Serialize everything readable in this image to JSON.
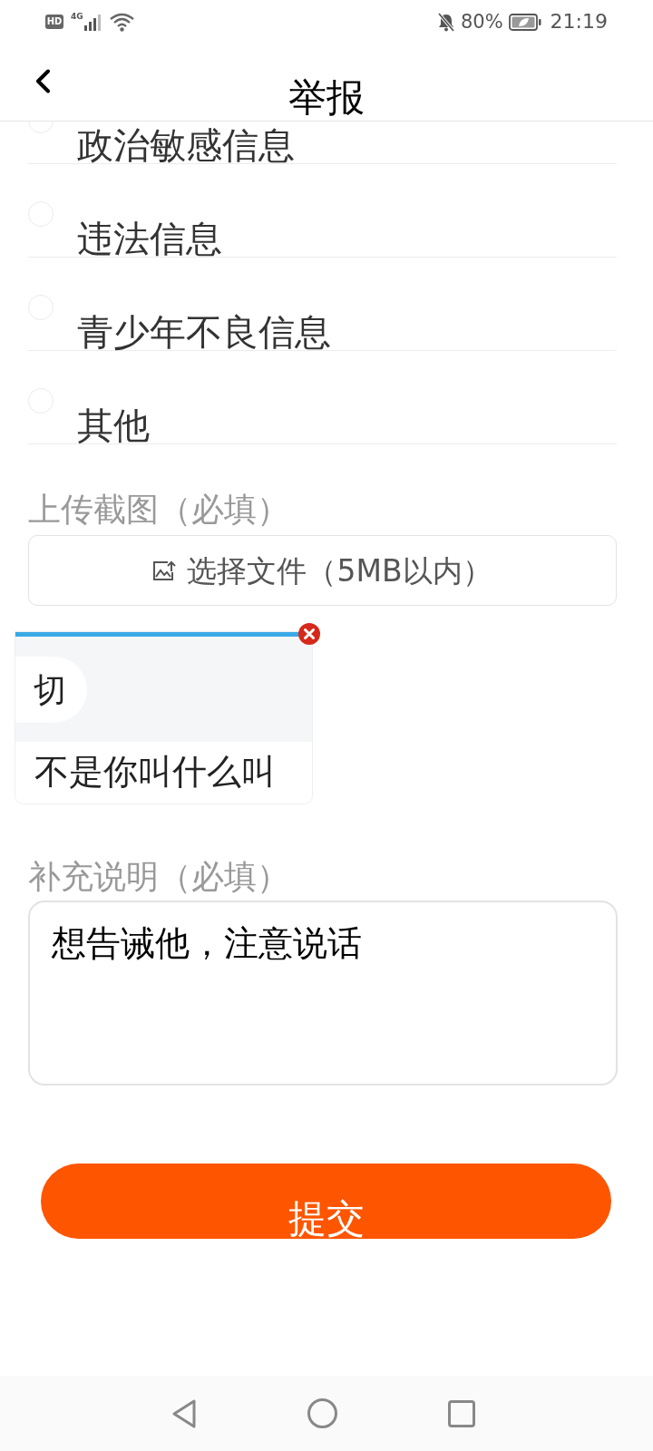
{
  "status_bar": {
    "hd": "HD",
    "network": "4G",
    "battery": "80%",
    "time": "21:19"
  },
  "header": {
    "title": "举报"
  },
  "report_reasons": [
    {
      "label": "政治敏感信息",
      "selected": false
    },
    {
      "label": "违法信息",
      "selected": false
    },
    {
      "label": "青少年不良信息",
      "selected": false
    },
    {
      "label": "其他",
      "selected": false
    }
  ],
  "screenshot_upload": {
    "label": "上传截图（必填）",
    "button": "选择文件（5MB以内）",
    "thumbnails": [
      {
        "messages": [
          {
            "kind": "bubble",
            "text": "切"
          },
          {
            "kind": "plain",
            "text": "不是你叫什么叫"
          }
        ]
      }
    ]
  },
  "description": {
    "label": "补充说明（必填）",
    "value": "想告诫他，注意说话"
  },
  "submit_button": "提交"
}
